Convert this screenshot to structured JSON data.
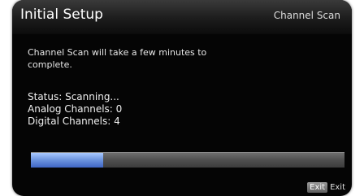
{
  "header": {
    "title": "Initial Setup",
    "screen_name": "Channel Scan"
  },
  "main": {
    "intro_text": "Channel Scan will take a few minutes to complete.",
    "status_text": "Status: Scanning...",
    "analog_channels_text": "Analog Channels: 0",
    "digital_channels_text": "Digital Channels: 4",
    "progress": 0.23
  },
  "footer": {
    "exit_key_label": "Exit",
    "exit_label": "Exit"
  },
  "colors": {
    "progress_fill": "#5b85d6",
    "background": "#050505"
  }
}
